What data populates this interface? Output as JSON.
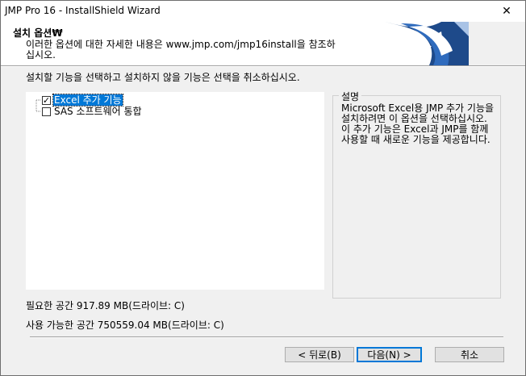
{
  "window": {
    "title": "JMP Pro 16 - InstallShield Wizard",
    "close_glyph": "✕"
  },
  "banner": {
    "title": "설치 옵션₩",
    "description": "이러한 옵션에 대한 자세한 내용은 www.jmp.com/jmp16install을 참조하십시오."
  },
  "instruction": "설치할 기능을 선택하고 설치하지 않을 기능은 선택을 취소하십시오.",
  "features": [
    {
      "label": "Excel 추가 기능",
      "checked": true,
      "selected": true
    },
    {
      "label": "SAS 소프트웨어 통합",
      "checked": false,
      "selected": false
    }
  ],
  "description_panel": {
    "legend": "설명",
    "text": "Microsoft Excel용 JMP 추가 기능을 설치하려면 이 옵션을 선택하십시오. 이 추가 기능은 Excel과 JMP를 함께 사용할 때 새로운 기능을 제공합니다."
  },
  "space": {
    "required": "필요한 공간 917.89 MB(드라이브: C)",
    "available": "사용 가능한 공간 750559.04 MB(드라이브: C)"
  },
  "buttons": {
    "back": "< 뒤로(B)",
    "next": "다음(N) >",
    "cancel": "취소"
  },
  "checkmark_glyph": "✓"
}
